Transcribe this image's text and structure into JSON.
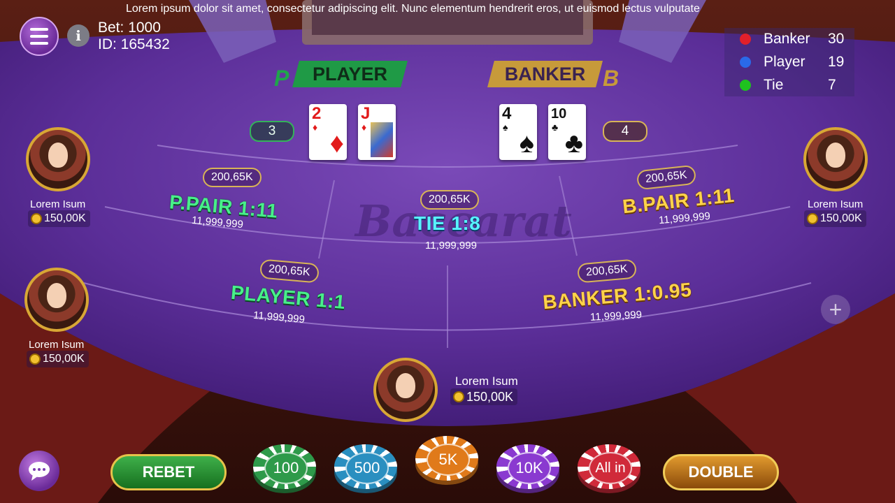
{
  "marquee": "Lorem ipsum dolor sit amet, consectetur adipiscing elit. Nunc elementum hendrerit eros, ut euismod lectus vulputate",
  "bet_info": {
    "bet": "Bet: 1000",
    "id": "ID: 165432"
  },
  "stats": [
    {
      "name": "Banker",
      "value": "30",
      "color": "#e0202a"
    },
    {
      "name": "Player",
      "value": "19",
      "color": "#2a6ae8"
    },
    {
      "name": "Tie",
      "value": "7",
      "color": "#1fc21f"
    }
  ],
  "headers": {
    "player": "PLAYER",
    "player_letter": "P",
    "banker": "BANKER",
    "banker_letter": "B"
  },
  "hands": {
    "player_score": "3",
    "banker_score": "4",
    "player_cards": [
      {
        "rank": "2",
        "suit": "♦"
      },
      {
        "rank": "J",
        "suit": "♦"
      }
    ],
    "banker_cards": [
      {
        "rank": "4",
        "suit": "♠"
      },
      {
        "rank": "10",
        "suit": "♣"
      }
    ]
  },
  "watermark": "Baccarat",
  "bets": {
    "p_pair": {
      "label": "P.PAIR  1:11",
      "chip": "200,65K",
      "amount": "11,999,999"
    },
    "tie": {
      "label": "TIE  1:8",
      "chip": "200,65K",
      "amount": "11,999,999"
    },
    "b_pair": {
      "label": "B.PAIR  1:11",
      "chip": "200,65K",
      "amount": "11,999,999"
    },
    "player": {
      "label": "PLAYER  1:1",
      "chip": "200,65K",
      "amount": "11,999,999"
    },
    "banker": {
      "label": "BANKER  1:0.95",
      "chip": "200,65K",
      "amount": "11,999,999"
    }
  },
  "players": [
    {
      "name": "Lorem Isum",
      "coins": "150,00K"
    },
    {
      "name": "Lorem Isum",
      "coins": "150,00K"
    },
    {
      "name": "Lorem Isum",
      "coins": "150,00K"
    },
    {
      "name": "Lorem Isum",
      "coins": "150,00K"
    }
  ],
  "controls": {
    "rebet": "REBET",
    "double": "DOUBLE",
    "chips": [
      {
        "label": "100",
        "color": "#2e9a4a"
      },
      {
        "label": "500",
        "color": "#2a8fc0"
      },
      {
        "label": "5K",
        "color": "#e07a1a"
      },
      {
        "label": "10K",
        "color": "#8a3ad0"
      },
      {
        "label": "All in",
        "color": "#d02a3a"
      }
    ]
  }
}
